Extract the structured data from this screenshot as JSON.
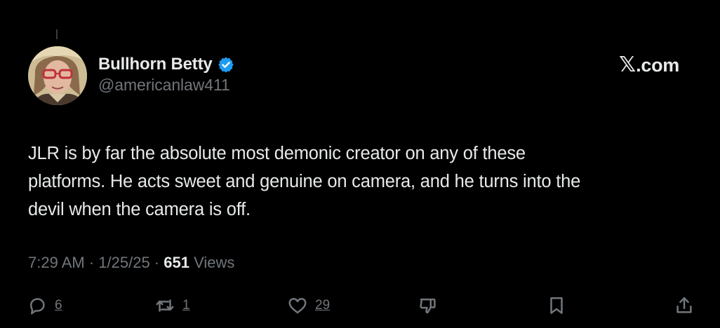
{
  "author": {
    "display_name": "Bullhorn Betty",
    "handle": "@americanlaw411",
    "verified": true,
    "verified_color": "#1d9bf0"
  },
  "branding": {
    "x_glyph": "𝕏",
    "suffix": ".com"
  },
  "tweet": {
    "line1": "JLR is by far the absolute most demonic creator on any of these",
    "line2": "platforms. He acts sweet and genuine on camera, and he turns into the",
    "line3": "devil when the camera is off."
  },
  "meta": {
    "time": "7:29 AM",
    "separator": " · ",
    "date": "1/25/25",
    "views_count": "651",
    "views_label": " Views"
  },
  "actions": {
    "replies": "6",
    "reposts": "1",
    "likes": "29"
  },
  "colors": {
    "background": "#000000",
    "text": "#e7e9ea",
    "muted": "#71767b"
  }
}
